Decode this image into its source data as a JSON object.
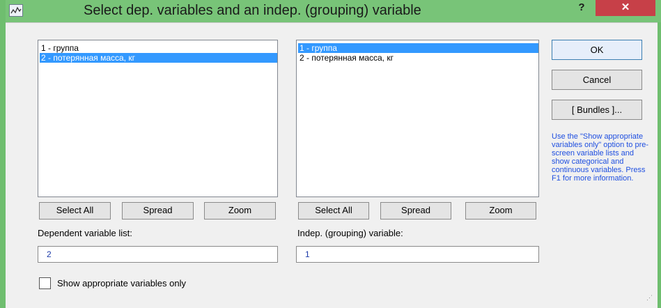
{
  "window": {
    "title": "Select dep. variables and an indep. (grouping) variable",
    "help_label": "?",
    "close_label": "✕"
  },
  "left_list": {
    "items": [
      {
        "label": "1 - группа",
        "selected": false
      },
      {
        "label": "2 - потерянная масса, кг",
        "selected": true
      }
    ],
    "select_all_label": "Select All",
    "spread_label": "Spread",
    "zoom_label": "Zoom",
    "field_label": "Dependent variable list:",
    "field_value": "2"
  },
  "right_list": {
    "items": [
      {
        "label": "1 - группа",
        "selected": true
      },
      {
        "label": "2 - потерянная масса, кг",
        "selected": false
      }
    ],
    "select_all_label": "Select All",
    "spread_label": "Spread",
    "zoom_label": "Zoom",
    "field_label": "Indep. (grouping) variable:",
    "field_value": "1"
  },
  "actions": {
    "ok_label": "OK",
    "cancel_label": "Cancel",
    "bundles_label": "[ Bundles ]..."
  },
  "hint": "Use the \"Show appropriate variables only\" option to pre-screen variable lists and show categorical and continuous variables. Press F1 for more information.",
  "checkbox": {
    "label": "Show appropriate variables only",
    "checked": false
  },
  "colors": {
    "selection": "#3399ff",
    "hint_text": "#1f4fe0",
    "close_button": "#c74048",
    "frame": "#78c478"
  },
  "icons": {
    "title_icon": "statistica-app-icon",
    "grip": "resize-grip-icon"
  }
}
